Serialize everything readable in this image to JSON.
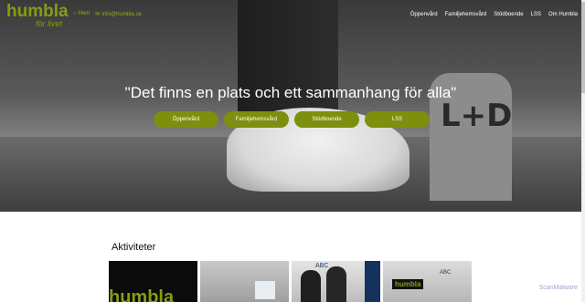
{
  "brand": {
    "logo_word": "humbla",
    "logo_sub": "för livet"
  },
  "contacts": {
    "home": "Hem",
    "email": "info@humbla.se"
  },
  "nav": [
    "Öppenvård",
    "Familjehemsvård",
    "Stödboende",
    "LSS",
    "Om Humbla"
  ],
  "hero": {
    "tagline": "\"Det finns en plats och ett sammanhang för alla\"",
    "wall_text": "L+D"
  },
  "buttons": [
    "Öppenvård",
    "Familjehemsvård",
    "Stödboende",
    "LSS"
  ],
  "activities": {
    "title": "Aktiviteter",
    "cards": [
      {
        "label": "humbla"
      },
      {
        "label": ""
      },
      {
        "label": "ABC"
      },
      {
        "label": "humbla",
        "banner": "ABC"
      }
    ]
  },
  "watermark": "ScanMalware"
}
